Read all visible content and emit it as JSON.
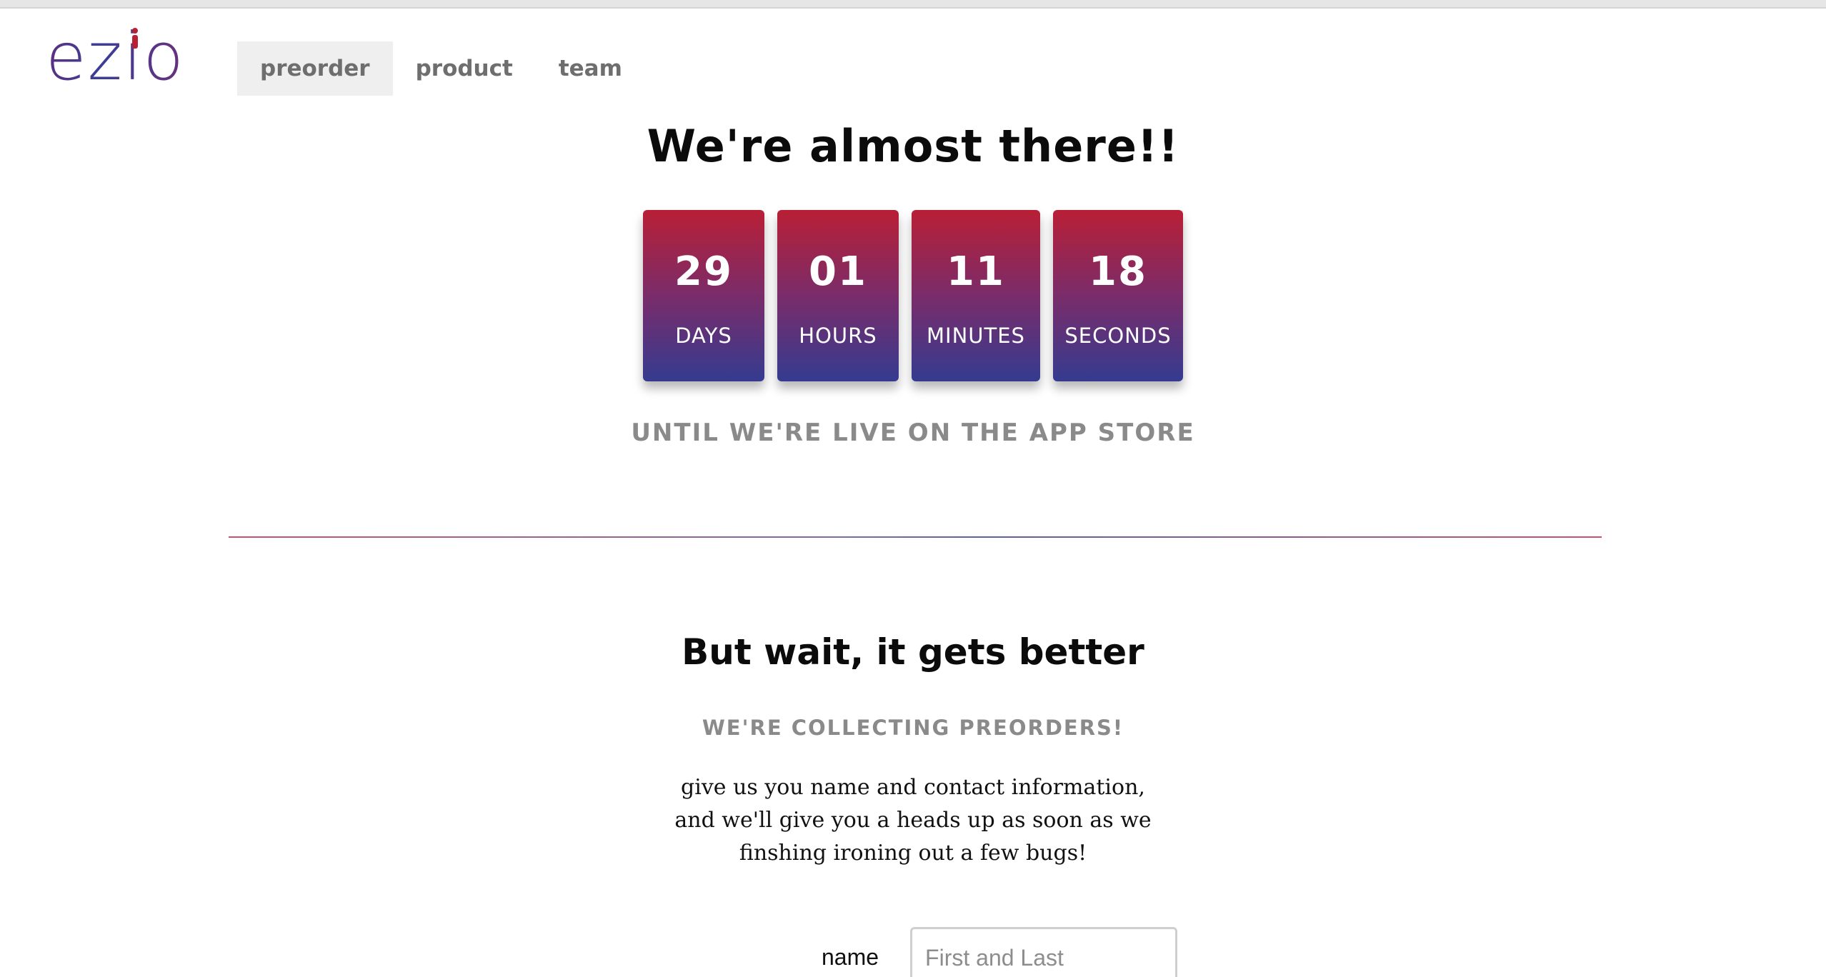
{
  "logo": {
    "text": "ezio"
  },
  "nav": {
    "items": [
      {
        "label": "preorder",
        "active": true
      },
      {
        "label": "product",
        "active": false
      },
      {
        "label": "team",
        "active": false
      }
    ]
  },
  "hero": {
    "headline": "We're almost there!!",
    "countdown": [
      {
        "value": "29",
        "unit": "DAYS"
      },
      {
        "value": "01",
        "unit": "HOURS"
      },
      {
        "value": "11",
        "unit": "MINUTES"
      },
      {
        "value": "18",
        "unit": "SECONDS"
      }
    ],
    "subtext": "UNTIL WE'RE LIVE ON THE APP STORE"
  },
  "preorder": {
    "title": "But wait, it gets better",
    "subtitle": "WE'RE COLLECTING PREORDERS!",
    "body_lines": [
      "give us you name and contact information,",
      "and we'll give you a heads up as soon as we",
      "finshing ironing out a few bugs!"
    ],
    "form": {
      "name_label": "name",
      "name_placeholder": "First and Last",
      "name_value": ""
    }
  },
  "colors": {
    "gradient_top": "#b91f35",
    "gradient_bottom": "#353b90",
    "muted_text": "#8a8a8a"
  }
}
